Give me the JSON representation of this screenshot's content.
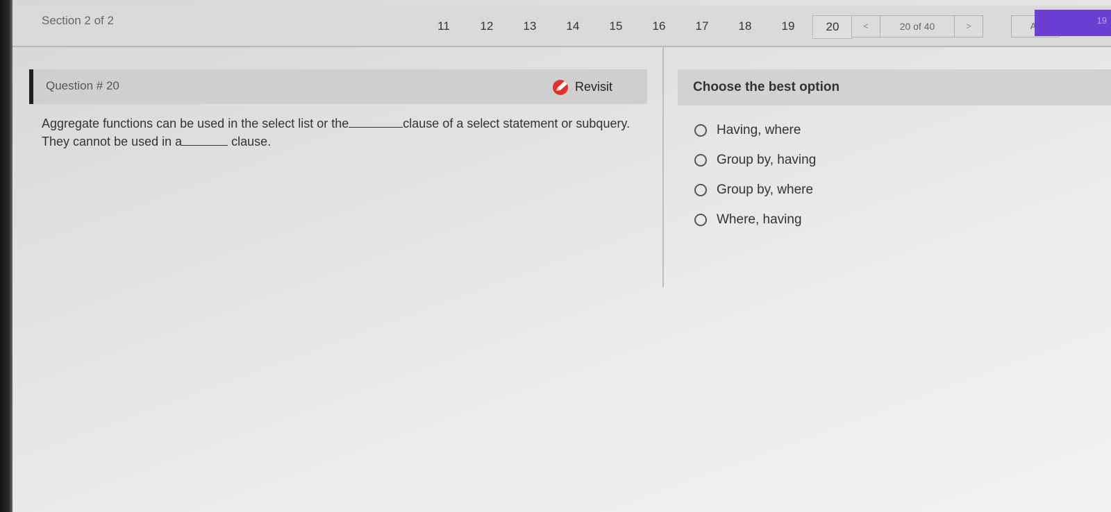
{
  "header": {
    "section_label": "Section 2 of 2",
    "question_numbers": [
      "11",
      "12",
      "13",
      "14",
      "15",
      "16",
      "17",
      "18",
      "19",
      "20"
    ],
    "current_question": "20",
    "pager": {
      "prev_label": "<",
      "count_label": "20 of 40",
      "next_label": ">"
    },
    "all_label": "All",
    "purple_strip_text": "19"
  },
  "question": {
    "title": "Question # 20",
    "revisit_label": "Revisit",
    "text_part1": "Aggregate functions can be used in the select list or the",
    "text_part2": "clause of a select statement or subquery. They cannot be used in a",
    "text_part3": "clause."
  },
  "options": {
    "title": "Choose the best option",
    "items": [
      "Having, where",
      "Group by, having",
      "Group by, where",
      "Where, having"
    ]
  },
  "colors": {
    "accent_purple": "#6b3fd4",
    "revisit_red": "#e0322d"
  }
}
